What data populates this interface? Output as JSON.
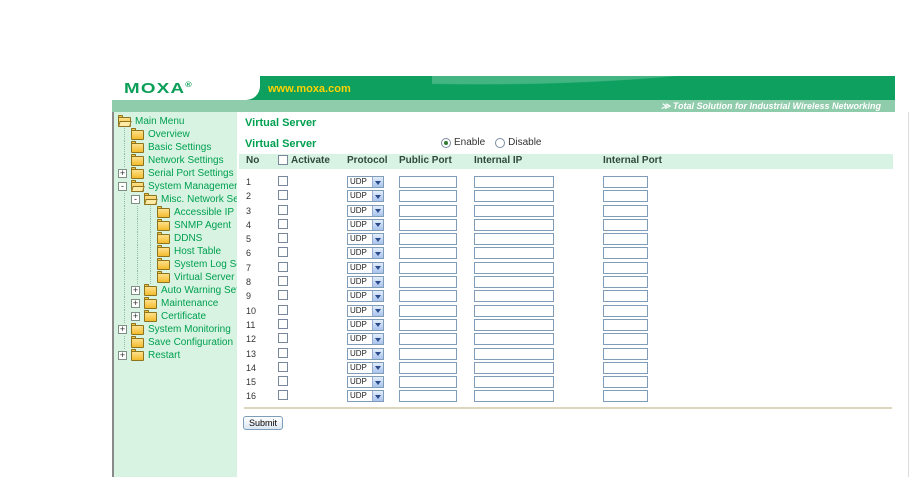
{
  "header": {
    "logo": "MOXA",
    "logo_registered": "®",
    "website": "www.moxa.com",
    "tagline_prefix": "≫",
    "tagline": "Total Solution for Industrial Wireless Networking"
  },
  "sidebar": {
    "items": [
      {
        "label": "Main Menu",
        "level": 0,
        "expand": null,
        "open": true
      },
      {
        "label": "Overview",
        "level": 1,
        "expand": null,
        "open": false
      },
      {
        "label": "Basic Settings",
        "level": 1,
        "expand": null,
        "open": false
      },
      {
        "label": "Network Settings",
        "level": 1,
        "expand": null,
        "open": false
      },
      {
        "label": "Serial Port Settings",
        "level": 1,
        "expand": "plus",
        "open": false
      },
      {
        "label": "System Management",
        "level": 1,
        "expand": "minus",
        "open": true
      },
      {
        "label": "Misc. Network Settings",
        "level": 2,
        "expand": "minus",
        "open": true
      },
      {
        "label": "Accessible IP List",
        "level": 3,
        "expand": null,
        "open": false
      },
      {
        "label": "SNMP Agent",
        "level": 3,
        "expand": null,
        "open": false
      },
      {
        "label": "DDNS",
        "level": 3,
        "expand": null,
        "open": false
      },
      {
        "label": "Host Table",
        "level": 3,
        "expand": null,
        "open": false
      },
      {
        "label": "System Log Settings",
        "level": 3,
        "expand": null,
        "open": false
      },
      {
        "label": "Virtual Server Settings",
        "level": 3,
        "expand": null,
        "open": false
      },
      {
        "label": "Auto Warning Settings",
        "level": 2,
        "expand": "plus",
        "open": false
      },
      {
        "label": "Maintenance",
        "level": 2,
        "expand": "plus",
        "open": false
      },
      {
        "label": "Certificate",
        "level": 2,
        "expand": "plus",
        "open": false
      },
      {
        "label": "System Monitoring",
        "level": 1,
        "expand": "plus",
        "open": false
      },
      {
        "label": "Save Configuration",
        "level": 1,
        "expand": null,
        "open": false
      },
      {
        "label": "Restart",
        "level": 1,
        "expand": "plus",
        "open": false
      }
    ]
  },
  "main": {
    "page_title": "Virtual Server",
    "field_label": "Virtual Server",
    "radios": [
      {
        "label": "Enable",
        "selected": true
      },
      {
        "label": "Disable",
        "selected": false
      }
    ],
    "table": {
      "columns": [
        "No",
        "Activate",
        "Protocol",
        "Public Port",
        "Internal IP",
        "Internal Port"
      ],
      "protocol_value": "UDP",
      "rows": [
        "1",
        "2",
        "3",
        "4",
        "5",
        "6",
        "7",
        "8",
        "9",
        "10",
        "11",
        "12",
        "13",
        "14",
        "15",
        "16"
      ],
      "activate_all_checked": false,
      "row_checkbox_checked": false,
      "input_values": {
        "public_port": "",
        "internal_ip": "",
        "internal_port": ""
      }
    },
    "submit_label": "Submit"
  },
  "colors": {
    "banner_green": "#0da05f",
    "tagline_bg": "#8fccab",
    "sidebar_bg": "#d8f3e2",
    "table_header_bg": "#d8f2e3",
    "link_green": "#00a050",
    "website_yellow": "#ffd200",
    "input_border": "#7f9db9",
    "rule_tan": "#ddd6ba"
  }
}
